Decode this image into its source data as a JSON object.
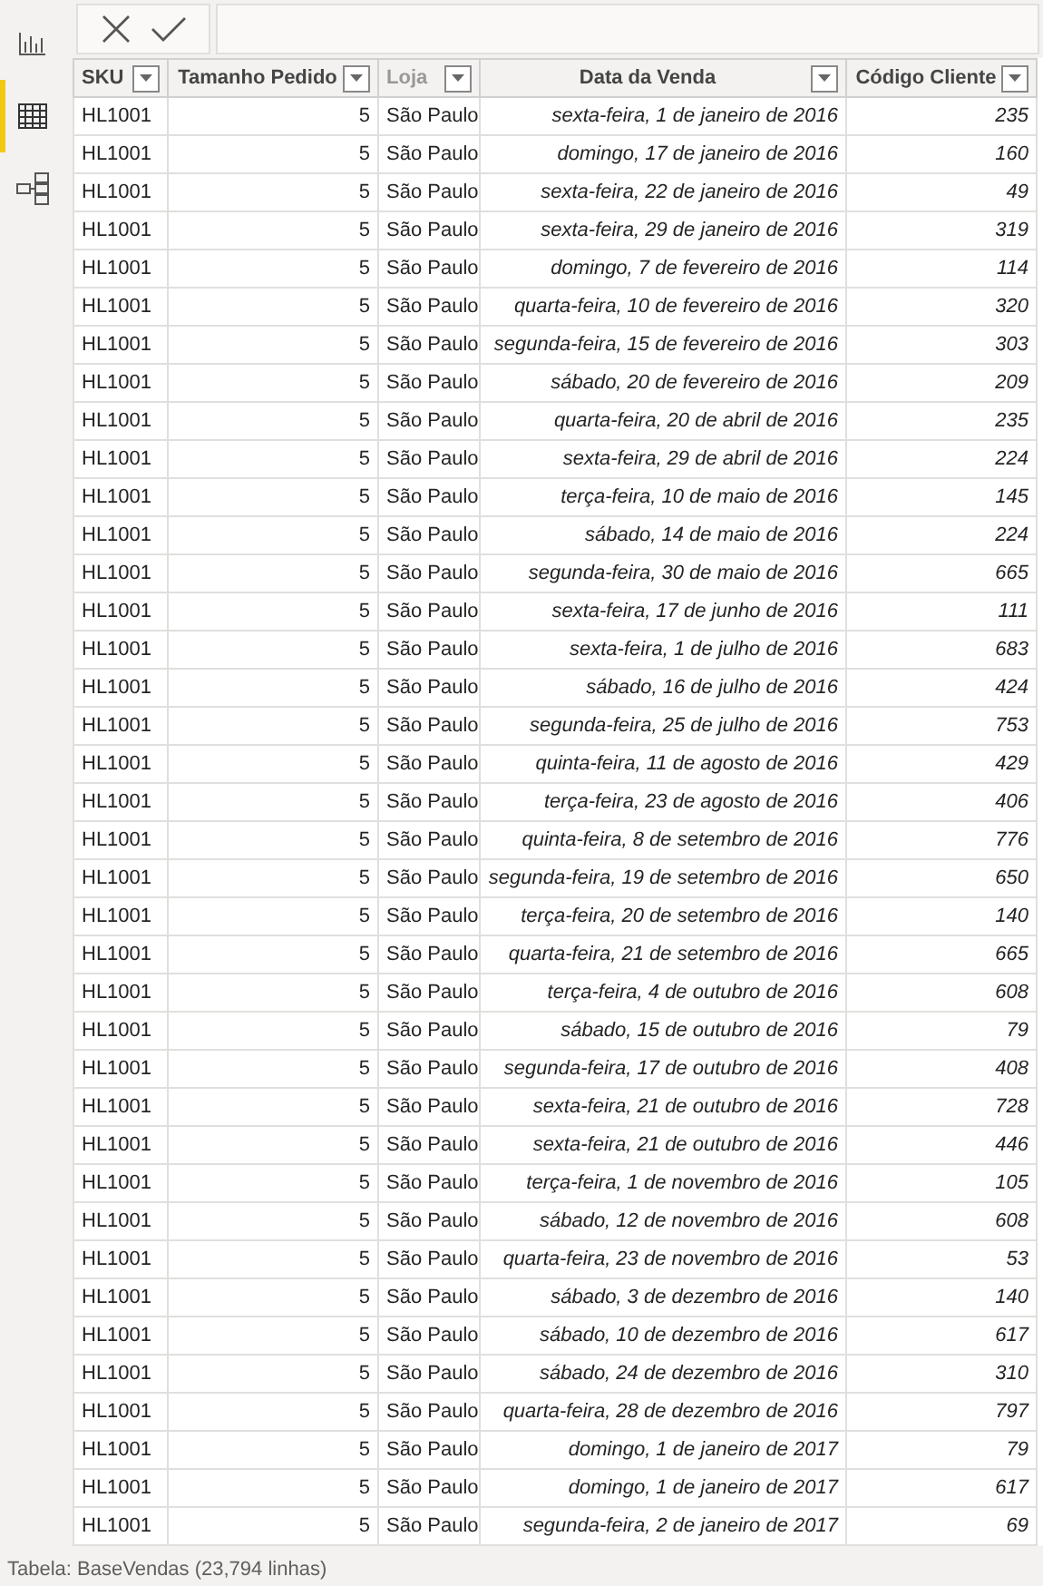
{
  "sidebar": {
    "items": [
      {
        "kind": "report",
        "selected": false
      },
      {
        "kind": "data",
        "selected": true
      },
      {
        "kind": "model",
        "selected": false
      }
    ]
  },
  "formula_bar": {
    "buttons": [
      {
        "kind": "cancel"
      },
      {
        "kind": "confirm"
      }
    ]
  },
  "table": {
    "columns": [
      {
        "label": "SKU",
        "dimmed": false
      },
      {
        "label": "Tamanho Pedido",
        "dimmed": false
      },
      {
        "label": "Loja",
        "dimmed": true
      },
      {
        "label": "Data da Venda",
        "dimmed": false
      },
      {
        "label": "Código Cliente",
        "dimmed": false
      }
    ],
    "rows": [
      [
        "HL1001",
        "5",
        "São Paulo",
        "sexta-feira, 1 de janeiro de 2016",
        "235"
      ],
      [
        "HL1001",
        "5",
        "São Paulo",
        "domingo, 17 de janeiro de 2016",
        "160"
      ],
      [
        "HL1001",
        "5",
        "São Paulo",
        "sexta-feira, 22 de janeiro de 2016",
        "49"
      ],
      [
        "HL1001",
        "5",
        "São Paulo",
        "sexta-feira, 29 de janeiro de 2016",
        "319"
      ],
      [
        "HL1001",
        "5",
        "São Paulo",
        "domingo, 7 de fevereiro de 2016",
        "114"
      ],
      [
        "HL1001",
        "5",
        "São Paulo",
        "quarta-feira, 10 de fevereiro de 2016",
        "320"
      ],
      [
        "HL1001",
        "5",
        "São Paulo",
        "segunda-feira, 15 de fevereiro de 2016",
        "303"
      ],
      [
        "HL1001",
        "5",
        "São Paulo",
        "sábado, 20 de fevereiro de 2016",
        "209"
      ],
      [
        "HL1001",
        "5",
        "São Paulo",
        "quarta-feira, 20 de abril de 2016",
        "235"
      ],
      [
        "HL1001",
        "5",
        "São Paulo",
        "sexta-feira, 29 de abril de 2016",
        "224"
      ],
      [
        "HL1001",
        "5",
        "São Paulo",
        "terça-feira, 10 de maio de 2016",
        "145"
      ],
      [
        "HL1001",
        "5",
        "São Paulo",
        "sábado, 14 de maio de 2016",
        "224"
      ],
      [
        "HL1001",
        "5",
        "São Paulo",
        "segunda-feira, 30 de maio de 2016",
        "665"
      ],
      [
        "HL1001",
        "5",
        "São Paulo",
        "sexta-feira, 17 de junho de 2016",
        "111"
      ],
      [
        "HL1001",
        "5",
        "São Paulo",
        "sexta-feira, 1 de julho de 2016",
        "683"
      ],
      [
        "HL1001",
        "5",
        "São Paulo",
        "sábado, 16 de julho de 2016",
        "424"
      ],
      [
        "HL1001",
        "5",
        "São Paulo",
        "segunda-feira, 25 de julho de 2016",
        "753"
      ],
      [
        "HL1001",
        "5",
        "São Paulo",
        "quinta-feira, 11 de agosto de 2016",
        "429"
      ],
      [
        "HL1001",
        "5",
        "São Paulo",
        "terça-feira, 23 de agosto de 2016",
        "406"
      ],
      [
        "HL1001",
        "5",
        "São Paulo",
        "quinta-feira, 8 de setembro de 2016",
        "776"
      ],
      [
        "HL1001",
        "5",
        "São Paulo",
        "segunda-feira, 19 de setembro de 2016",
        "650"
      ],
      [
        "HL1001",
        "5",
        "São Paulo",
        "terça-feira, 20 de setembro de 2016",
        "140"
      ],
      [
        "HL1001",
        "5",
        "São Paulo",
        "quarta-feira, 21 de setembro de 2016",
        "665"
      ],
      [
        "HL1001",
        "5",
        "São Paulo",
        "terça-feira, 4 de outubro de 2016",
        "608"
      ],
      [
        "HL1001",
        "5",
        "São Paulo",
        "sábado, 15 de outubro de 2016",
        "79"
      ],
      [
        "HL1001",
        "5",
        "São Paulo",
        "segunda-feira, 17 de outubro de 2016",
        "408"
      ],
      [
        "HL1001",
        "5",
        "São Paulo",
        "sexta-feira, 21 de outubro de 2016",
        "728"
      ],
      [
        "HL1001",
        "5",
        "São Paulo",
        "sexta-feira, 21 de outubro de 2016",
        "446"
      ],
      [
        "HL1001",
        "5",
        "São Paulo",
        "terça-feira, 1 de novembro de 2016",
        "105"
      ],
      [
        "HL1001",
        "5",
        "São Paulo",
        "sábado, 12 de novembro de 2016",
        "608"
      ],
      [
        "HL1001",
        "5",
        "São Paulo",
        "quarta-feira, 23 de novembro de 2016",
        "53"
      ],
      [
        "HL1001",
        "5",
        "São Paulo",
        "sábado, 3 de dezembro de 2016",
        "140"
      ],
      [
        "HL1001",
        "5",
        "São Paulo",
        "sábado, 10 de dezembro de 2016",
        "617"
      ],
      [
        "HL1001",
        "5",
        "São Paulo",
        "sábado, 24 de dezembro de 2016",
        "310"
      ],
      [
        "HL1001",
        "5",
        "São Paulo",
        "quarta-feira, 28 de dezembro de 2016",
        "797"
      ],
      [
        "HL1001",
        "5",
        "São Paulo",
        "domingo, 1 de janeiro de 2017",
        "79"
      ],
      [
        "HL1001",
        "5",
        "São Paulo",
        "domingo, 1 de janeiro de 2017",
        "617"
      ],
      [
        "HL1001",
        "5",
        "São Paulo",
        "segunda-feira, 2 de janeiro de 2017",
        "69"
      ]
    ]
  },
  "status_bar": "Tabela: BaseVendas (23,794 linhas)"
}
